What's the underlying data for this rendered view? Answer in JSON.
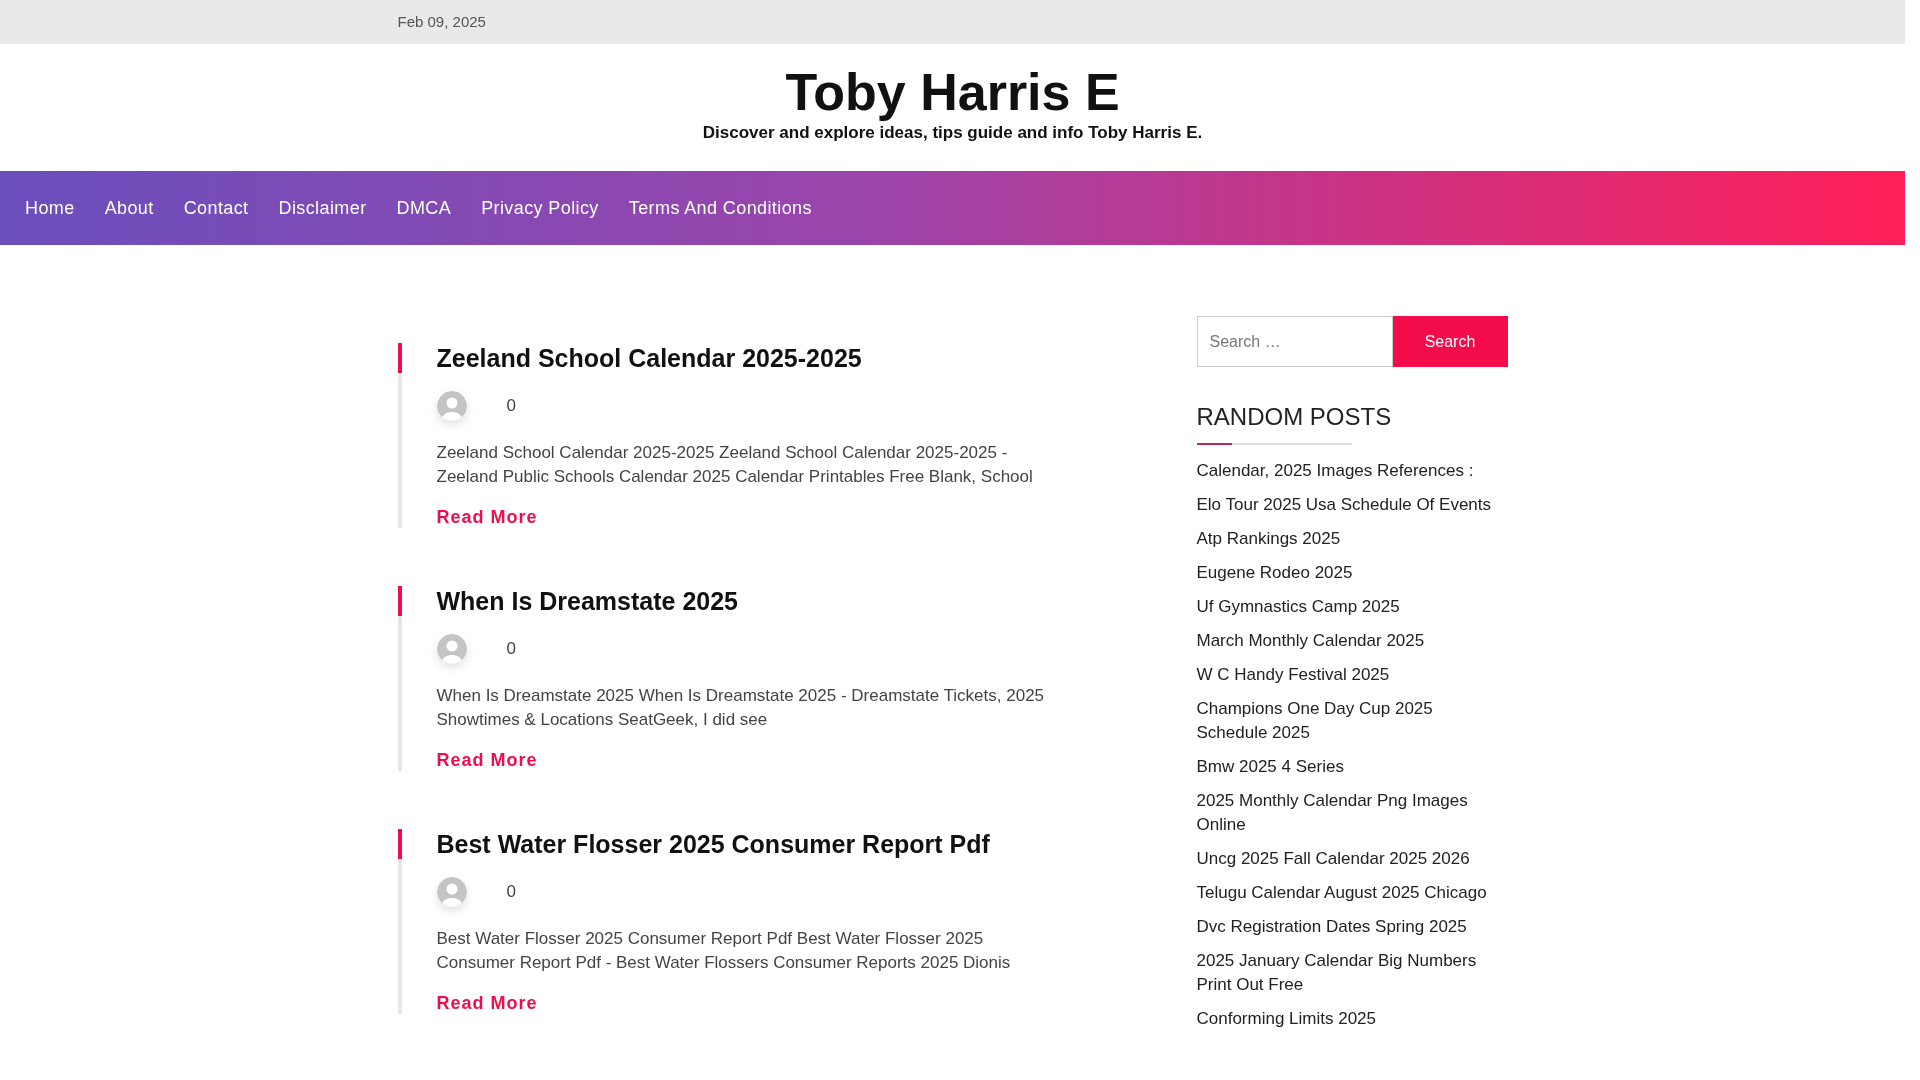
{
  "top_bar": {
    "date": "Feb 09, 2025"
  },
  "site": {
    "title": "Toby Harris E",
    "tagline": "Discover and explore ideas, tips guide and info Toby Harris E."
  },
  "nav": [
    "Home",
    "About",
    "Contact",
    "Disclaimer",
    "DMCA",
    "Privacy Policy",
    "Terms And Conditions"
  ],
  "posts": [
    {
      "title": "Zeeland School Calendar 2025-2025",
      "comments": "0",
      "excerpt": "Zeeland School Calendar 2025-2025 Zeeland School Calendar 2025-2025 - Zeeland Public Schools Calendar 2025 Calendar Printables Free Blank, School",
      "read_more": "Read More"
    },
    {
      "title": "When Is Dreamstate 2025",
      "comments": "0",
      "excerpt": "When Is Dreamstate 2025 When Is Dreamstate 2025 - Dreamstate Tickets, 2025 Showtimes & Locations SeatGeek, I did see",
      "read_more": "Read More"
    },
    {
      "title": "Best Water Flosser 2025 Consumer Report Pdf",
      "comments": "0",
      "excerpt": "Best Water Flosser 2025 Consumer Report Pdf Best Water Flosser 2025 Consumer Report Pdf - Best Water Flossers Consumer Reports 2025 Dionis",
      "read_more": "Read More"
    }
  ],
  "search": {
    "placeholder": "Search …",
    "button": "Search"
  },
  "random_posts": {
    "heading": "RANDOM POSTS",
    "items": [
      "Calendar, 2025 Images References :",
      "Elo Tour 2025 Usa Schedule Of Events",
      "Atp Rankings 2025",
      "Eugene Rodeo 2025",
      "Uf Gymnastics Camp 2025",
      "March Monthly Calendar 2025",
      "W C Handy Festival 2025",
      "Champions One Day Cup 2025 Schedule 2025",
      "Bmw 2025 4 Series",
      "2025 Monthly Calendar Png Images Online",
      "Uncg 2025 Fall Calendar 2025 2026",
      "Telugu Calendar August 2025 Chicago",
      "Dvc Registration Dates Spring 2025",
      "2025 January Calendar Big Numbers Print Out Free",
      "Conforming Limits 2025"
    ]
  }
}
